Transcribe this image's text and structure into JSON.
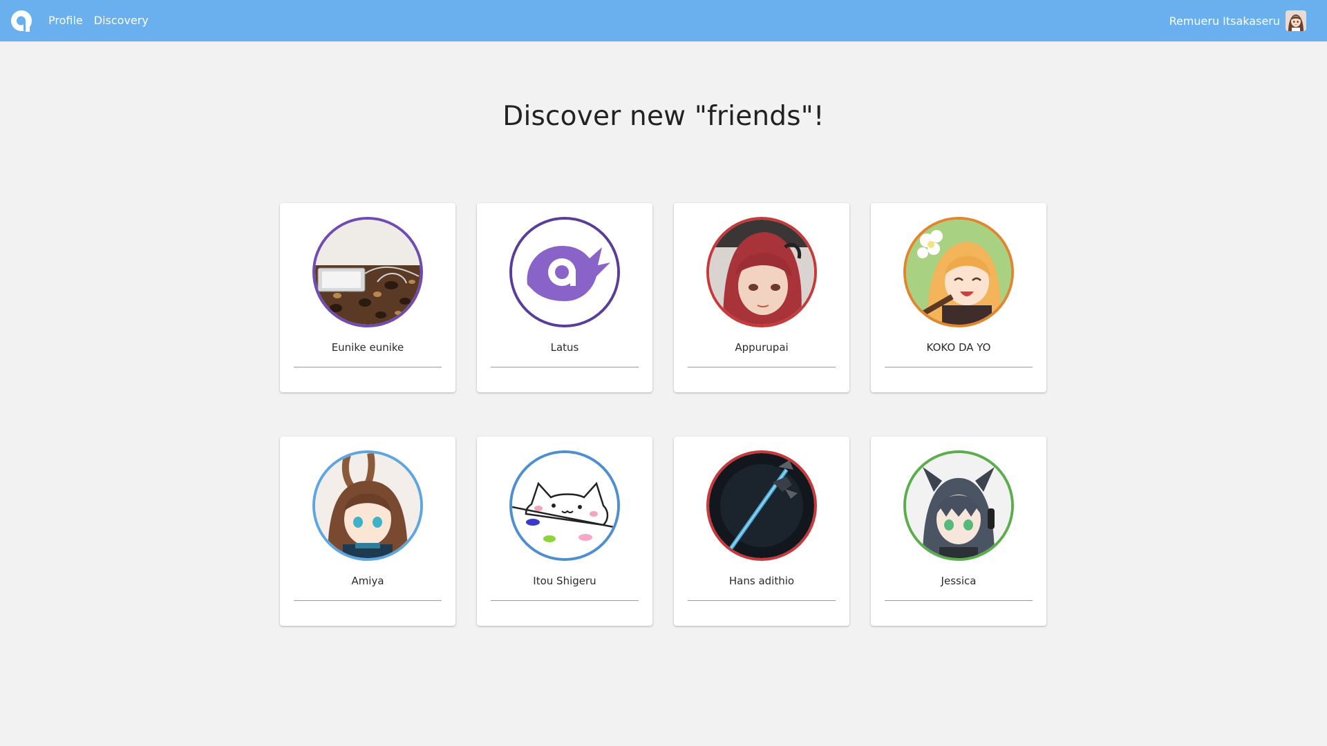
{
  "nav": {
    "links": [
      "Profile",
      "Discovery"
    ],
    "user_name": "Remueru Itsakaseru"
  },
  "page": {
    "title": "Discover new \"friends\"!"
  },
  "friends": [
    {
      "name": "Eunike eunike",
      "ring": "#6f4bb3",
      "avatar": "photo-phone-on-leopard-fabric"
    },
    {
      "name": "Latus",
      "ring": "#5a3d99",
      "avatar": "purple-bird-logo"
    },
    {
      "name": "Appurupai",
      "ring": "#c83a3a",
      "avatar": "red-haired-anime-boy"
    },
    {
      "name": "KOKO DA YO",
      "ring": "#e0862f",
      "avatar": "blonde-anime-girl"
    },
    {
      "name": "Amiya",
      "ring": "#5ea6e2",
      "avatar": "anime-girl-bunny-ears"
    },
    {
      "name": "Itou Shigeru",
      "ring": "#4f8fd0",
      "avatar": "bongo-cat"
    },
    {
      "name": "Hans adithio",
      "ring": "#c8383d",
      "avatar": "dark-sword"
    },
    {
      "name": "Jessica",
      "ring": "#5cad4b",
      "avatar": "anime-girl-cat-ears"
    }
  ],
  "colors": {
    "header": "#6ab0ee",
    "background": "#f2f2f2",
    "card": "#ffffff"
  },
  "icons": {
    "logo": "app-logo-icon",
    "user": "user-avatar"
  }
}
